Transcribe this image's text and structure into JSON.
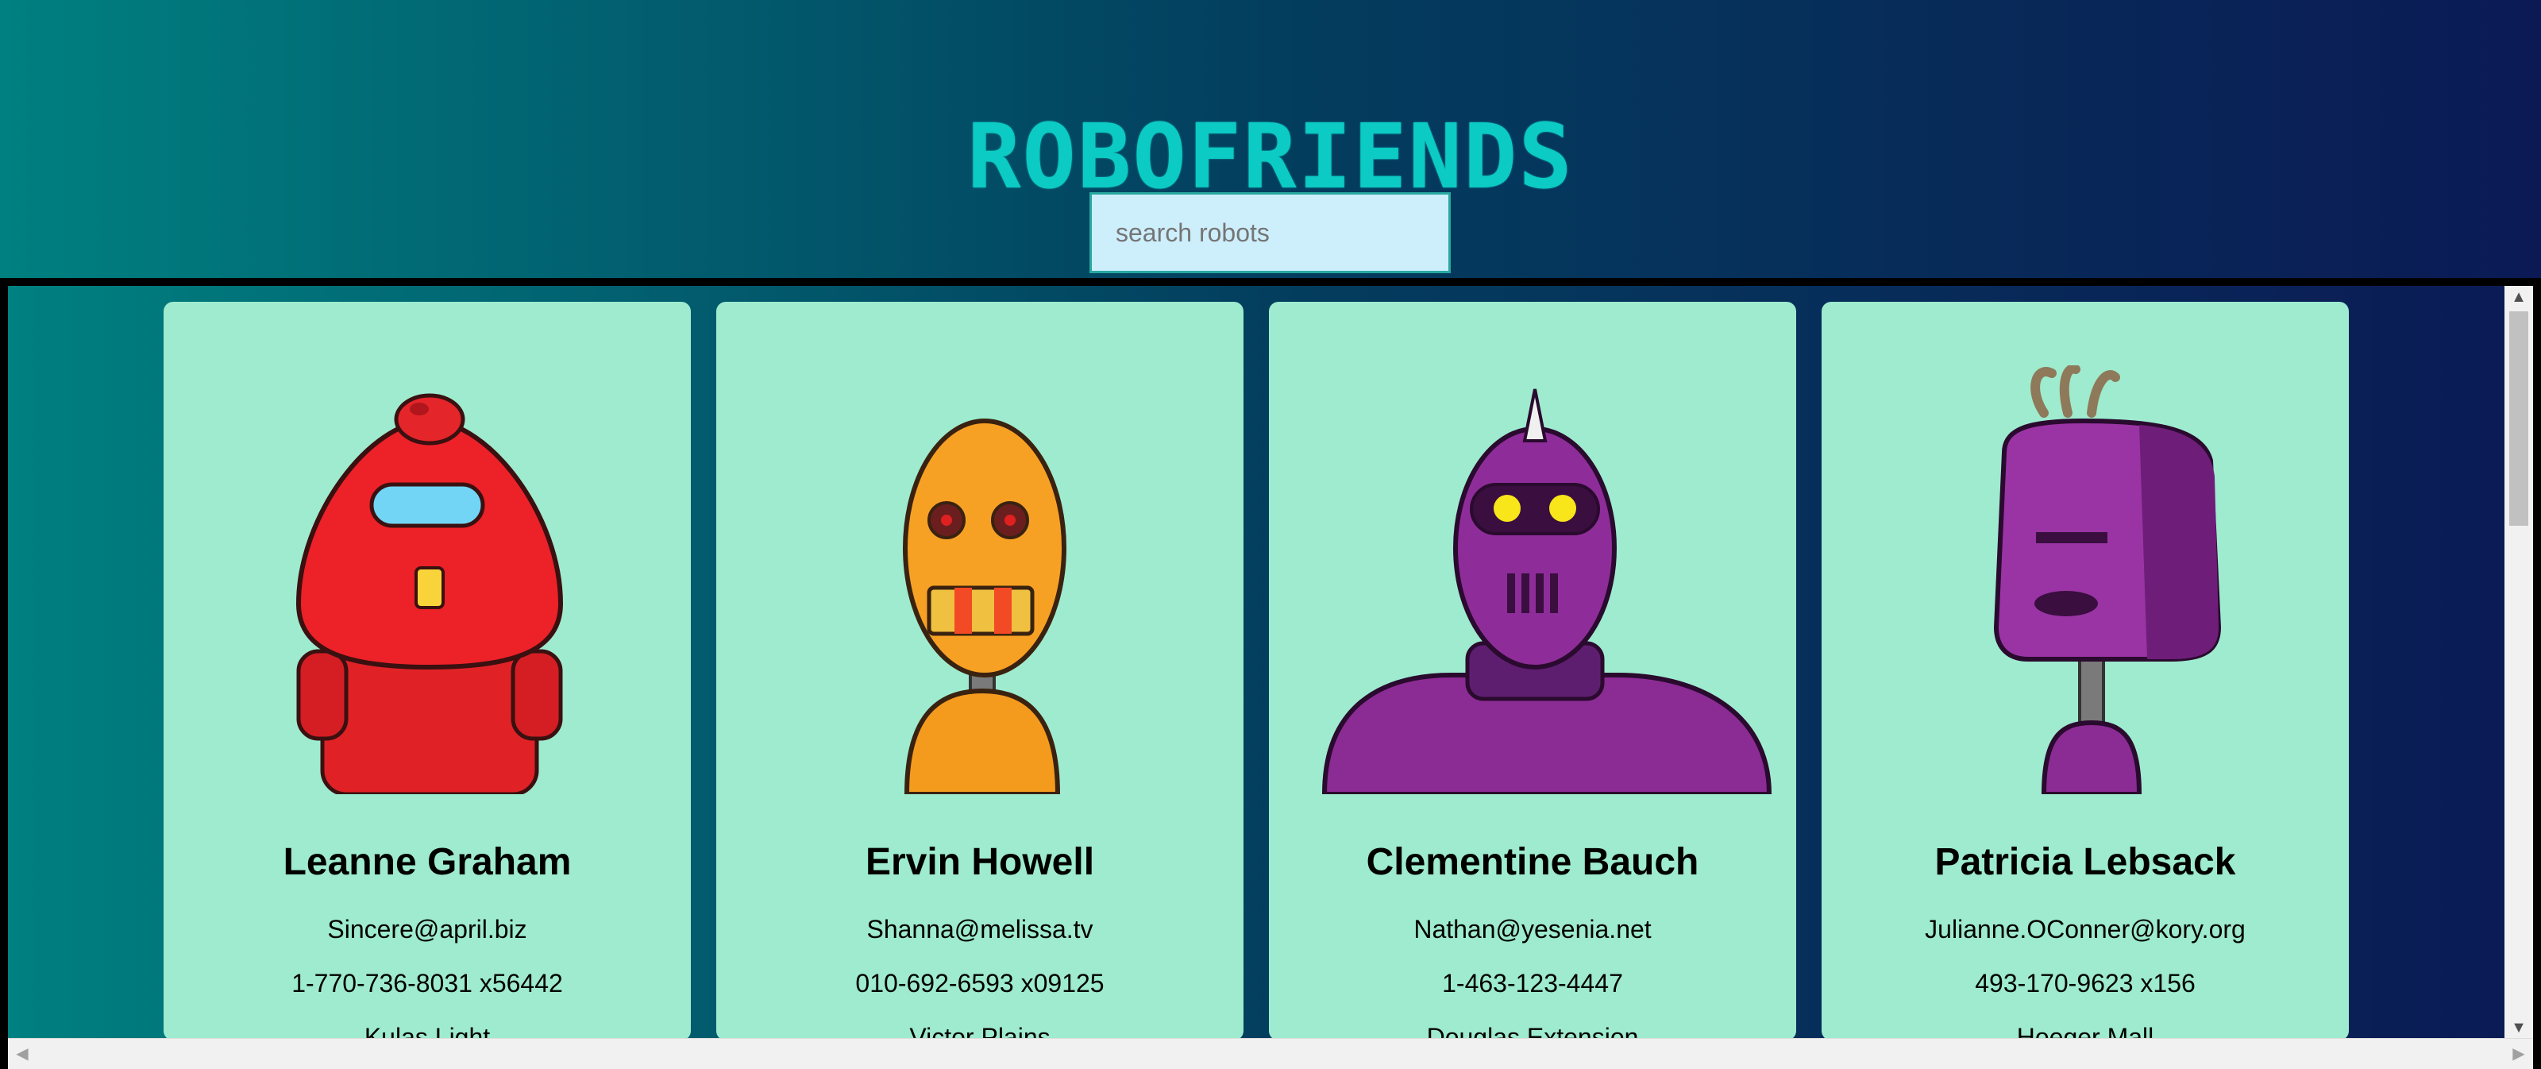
{
  "header": {
    "title": "ROBOFRIENDS"
  },
  "search": {
    "placeholder": "search robots",
    "value": ""
  },
  "robots": [
    {
      "name": "Leanne Graham",
      "email": "Sincere@april.biz",
      "phone": "1-770-736-8031 x56442",
      "street": "Kulas Light"
    },
    {
      "name": "Ervin Howell",
      "email": "Shanna@melissa.tv",
      "phone": "010-692-6593 x09125",
      "street": "Victor Plains"
    },
    {
      "name": "Clementine Bauch",
      "email": "Nathan@yesenia.net",
      "phone": "1-463-123-4447",
      "street": "Douglas Extension"
    },
    {
      "name": "Patricia Lebsack",
      "email": "Julianne.OConner@kory.org",
      "phone": "493-170-9623 x156",
      "street": "Hoeger Mall"
    }
  ],
  "colors": {
    "card_bg": "#9eebcf",
    "title": "#0ccac4",
    "search_bg": "#cdeefb"
  }
}
